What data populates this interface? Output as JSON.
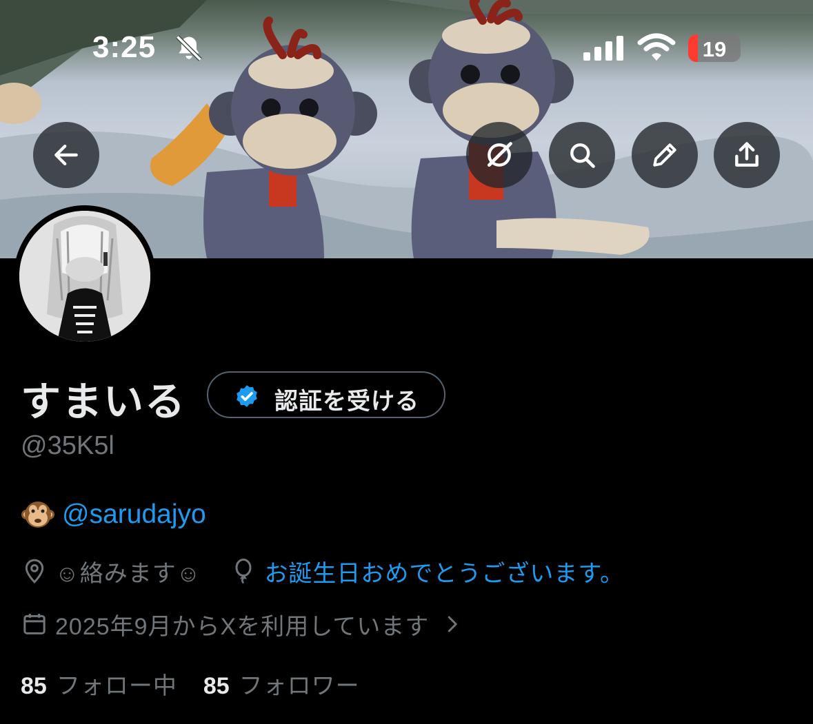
{
  "status_bar": {
    "time": "3:25",
    "battery_level": "19",
    "icons": [
      "bell-slash-icon",
      "cellular-signal-icon",
      "wifi-icon",
      "battery-icon"
    ]
  },
  "header_buttons": [
    {
      "name": "back-button",
      "icon": "arrow-left-icon"
    },
    {
      "name": "grok-button",
      "icon": "grok-icon"
    },
    {
      "name": "search-button",
      "icon": "search-icon"
    },
    {
      "name": "edit-button",
      "icon": "pencil-icon"
    },
    {
      "name": "share-button",
      "icon": "share-icon"
    }
  ],
  "profile": {
    "display_name": "すまいる",
    "handle": "@35K5l",
    "verify_button_label": "認証を受ける",
    "bio_emoji": "🐵",
    "bio_mention": "@sarudajyo",
    "location": "☺絡みます☺",
    "birthday": "お誕生日おめでとうございます。",
    "joined": "2025年9月からXを利用しています",
    "following_count": "85",
    "following_label": "フォロー中",
    "followers_count": "85",
    "followers_label": "フォロワー"
  },
  "colors": {
    "accent_blue": "#1d9bf0",
    "secondary_text": "#71767b",
    "primary_text": "#e7e9ea",
    "background": "#000000",
    "battery_low": "#ff3b30"
  }
}
